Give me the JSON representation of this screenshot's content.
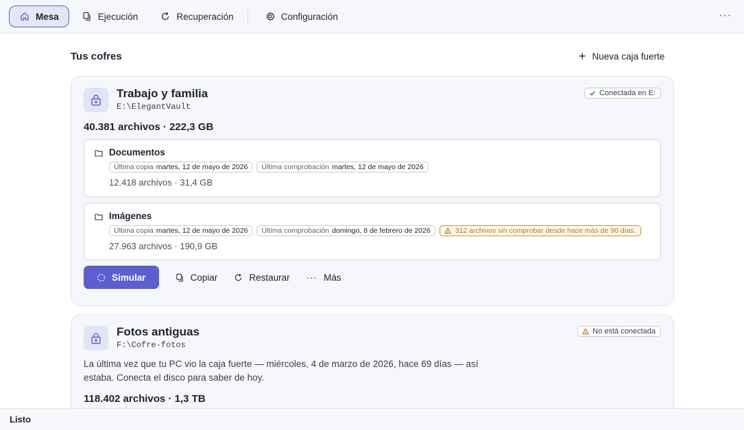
{
  "nav": {
    "items": [
      {
        "label": "Mesa",
        "icon": "home-icon",
        "active": true
      },
      {
        "label": "Ejecución",
        "icon": "copy-icon"
      },
      {
        "label": "Recuperación",
        "icon": "refresh-icon"
      },
      {
        "label": "Configuración",
        "icon": "gear-icon"
      }
    ],
    "more": "···"
  },
  "main": {
    "title": "Tus cofres",
    "new_vault": "Nueva caja fuerte"
  },
  "vaults": [
    {
      "name": "Trabajo y familia",
      "path": "E:\\ElegantVault",
      "status": "Conectada en E:",
      "summary": "40.381 archivos · 222,3 GB",
      "folders": [
        {
          "name": "Documentos",
          "last_copy_label": "Última copia",
          "last_copy": "martes, 12 de mayo de 2026",
          "last_check_label": "Última comprobación",
          "last_check": "martes, 12 de mayo de 2026",
          "stats": "12.418 archivos · 31,4 GB"
        },
        {
          "name": "Imágenes",
          "last_copy_label": "Última copia",
          "last_copy": "martes, 12 de mayo de 2026",
          "last_check_label": "Última comprobación",
          "last_check": "domingo, 8 de febrero de 2026",
          "warning": "312 archivos sin comprobar desde hace más de 90 días.",
          "stats": "27.963 archivos · 190,9 GB"
        }
      ],
      "actions": {
        "simulate": "Simular",
        "copy": "Copiar",
        "restore": "Restaurar",
        "more": "Más"
      }
    },
    {
      "name": "Fotos antiguas",
      "path": "F:\\Cofre-fotos",
      "status": "No está conectada",
      "description": "La última vez que tu PC vio la caja fuerte — miércoles, 4 de marzo de 2026, hace 69 días — así estaba. Conecta el disco para saber de hoy.",
      "summary": "118.402 archivos · 1,3 TB"
    }
  ],
  "statusbar": {
    "text": "Listo"
  },
  "colors": {
    "accent": "#5b5fcf",
    "warning": "#b0721a",
    "ok": "#2e8b3e"
  }
}
